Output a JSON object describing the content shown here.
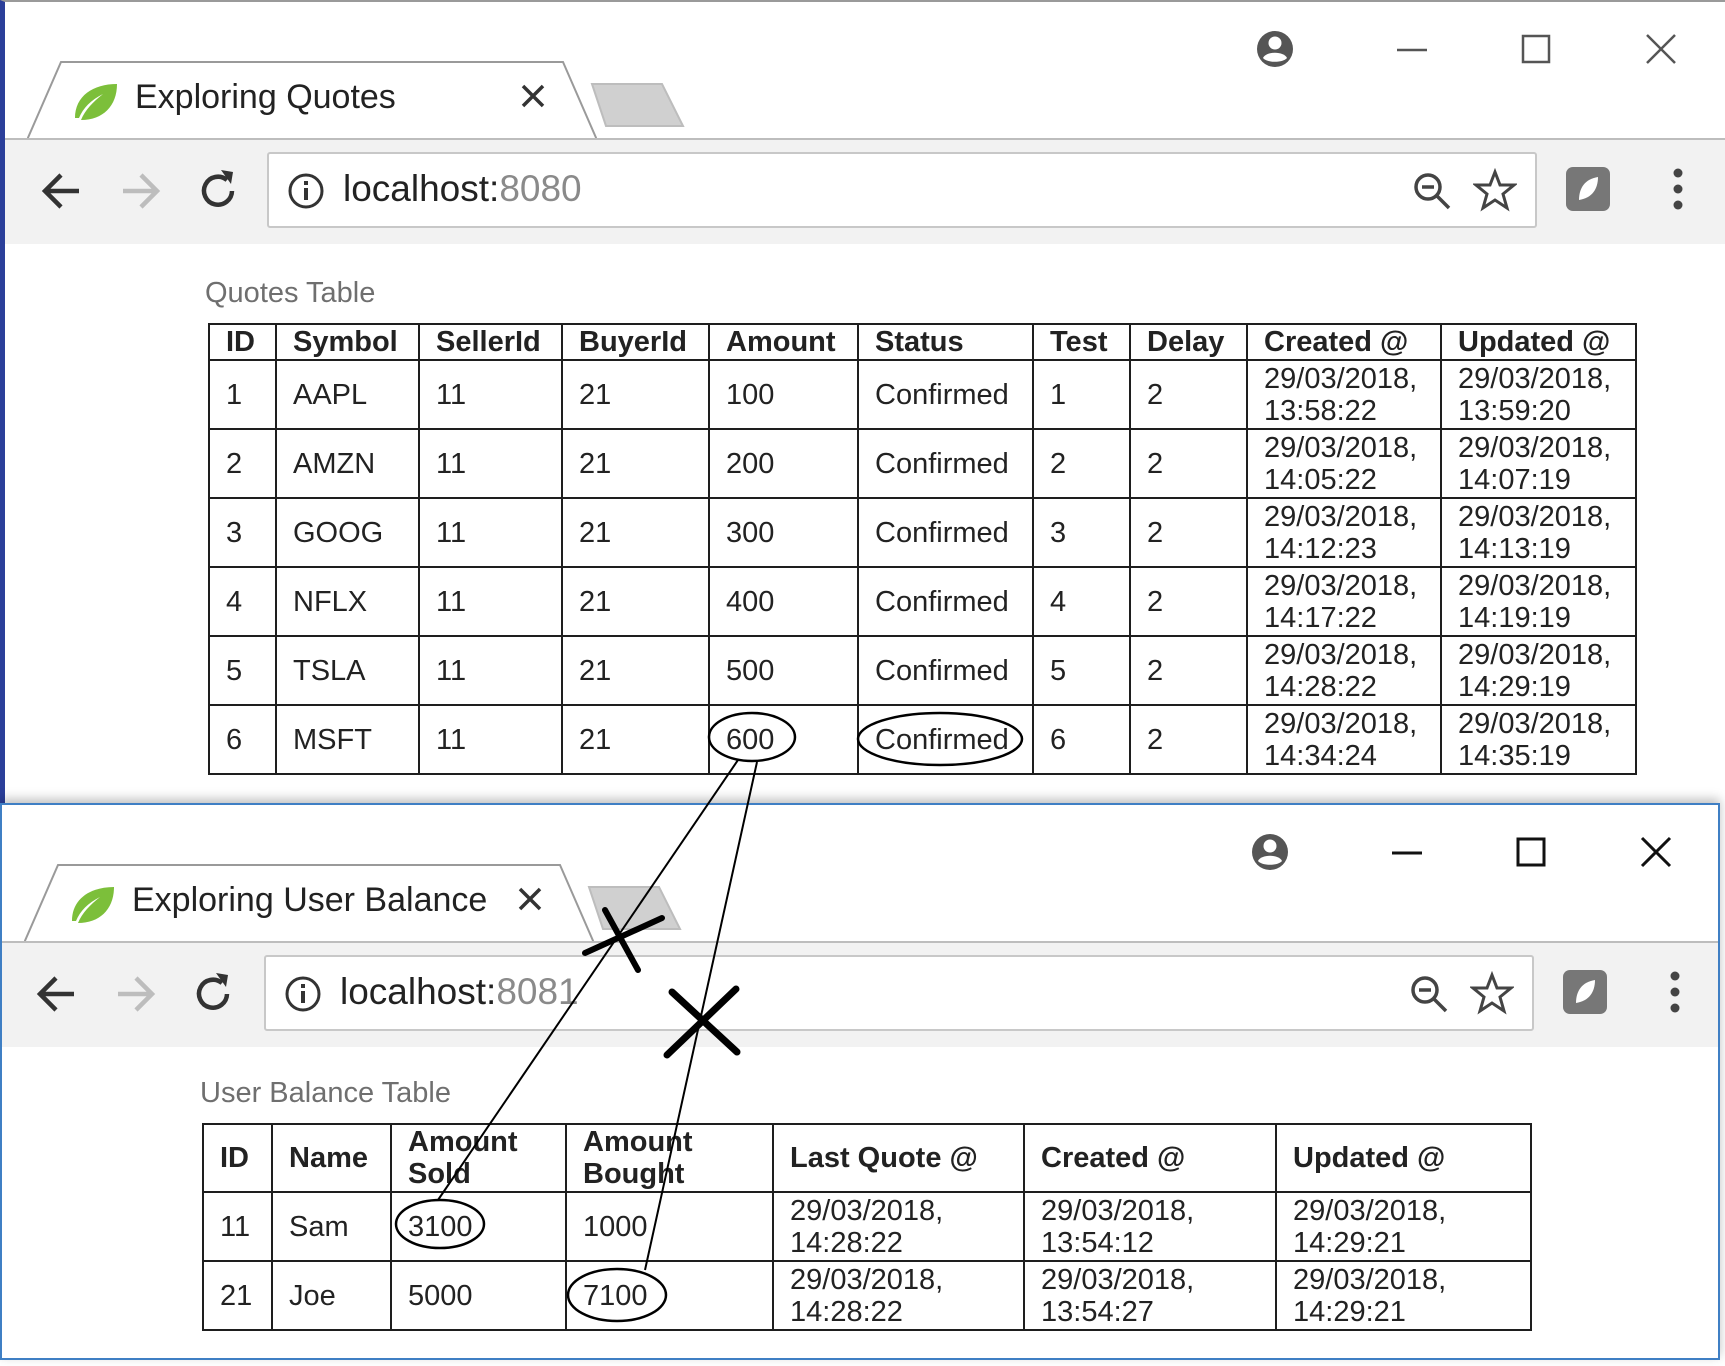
{
  "windows": {
    "quotes": {
      "tab_title": "Exploring Quotes",
      "url_host": "localhost:",
      "url_port": "8080",
      "table_caption": "Quotes Table",
      "columns": [
        "ID",
        "Symbol",
        "SellerId",
        "BuyerId",
        "Amount",
        "Status",
        "Test",
        "Delay",
        "Created @",
        "Updated @"
      ],
      "rows": [
        [
          "1",
          "AAPL",
          "11",
          "21",
          "100",
          "Confirmed",
          "1",
          "2",
          "29/03/2018,\n13:58:22",
          "29/03/2018,\n13:59:20"
        ],
        [
          "2",
          "AMZN",
          "11",
          "21",
          "200",
          "Confirmed",
          "2",
          "2",
          "29/03/2018,\n14:05:22",
          "29/03/2018,\n14:07:19"
        ],
        [
          "3",
          "GOOG",
          "11",
          "21",
          "300",
          "Confirmed",
          "3",
          "2",
          "29/03/2018,\n14:12:23",
          "29/03/2018,\n14:13:19"
        ],
        [
          "4",
          "NFLX",
          "11",
          "21",
          "400",
          "Confirmed",
          "4",
          "2",
          "29/03/2018,\n14:17:22",
          "29/03/2018,\n14:19:19"
        ],
        [
          "5",
          "TSLA",
          "11",
          "21",
          "500",
          "Confirmed",
          "5",
          "2",
          "29/03/2018,\n14:28:22",
          "29/03/2018,\n14:29:19"
        ],
        [
          "6",
          "MSFT",
          "11",
          "21",
          "600",
          "Confirmed",
          "6",
          "2",
          "29/03/2018,\n14:34:24",
          "29/03/2018,\n14:35:19"
        ]
      ]
    },
    "balance": {
      "tab_title": "Exploring User Balance",
      "url_host": "localhost:",
      "url_port": "8081",
      "table_caption": "User Balance Table",
      "columns": [
        "ID",
        "Name",
        "Amount\nSold",
        "Amount\nBought",
        "Last Quote @",
        "Created @",
        "Updated @"
      ],
      "rows": [
        [
          "11",
          "Sam",
          "3100",
          "1000",
          "29/03/2018,\n14:28:22",
          "29/03/2018,\n13:54:12",
          "29/03/2018,\n14:29:21"
        ],
        [
          "21",
          "Joe",
          "5000",
          "7100",
          "29/03/2018,\n14:28:22",
          "29/03/2018,\n13:54:27",
          "29/03/2018,\n14:29:21"
        ]
      ]
    }
  },
  "icons": {
    "favicon": "spring-leaf-icon",
    "tab_close": "close-icon",
    "profile": "account-circle-icon",
    "minimize": "minimize-icon",
    "maximize": "maximize-icon",
    "close_window": "close-icon",
    "back": "arrow-left-icon",
    "forward": "arrow-right-icon",
    "reload": "reload-icon",
    "site_info": "info-icon",
    "zoom": "zoom-out-icon",
    "bookmark": "star-icon",
    "extension": "extension-icon",
    "menu": "kebab-menu-icon"
  },
  "colors": {
    "favicon_green": "#7cbf3a",
    "annotation_ink": "#000000",
    "window_accent": "#3f7fc4"
  }
}
